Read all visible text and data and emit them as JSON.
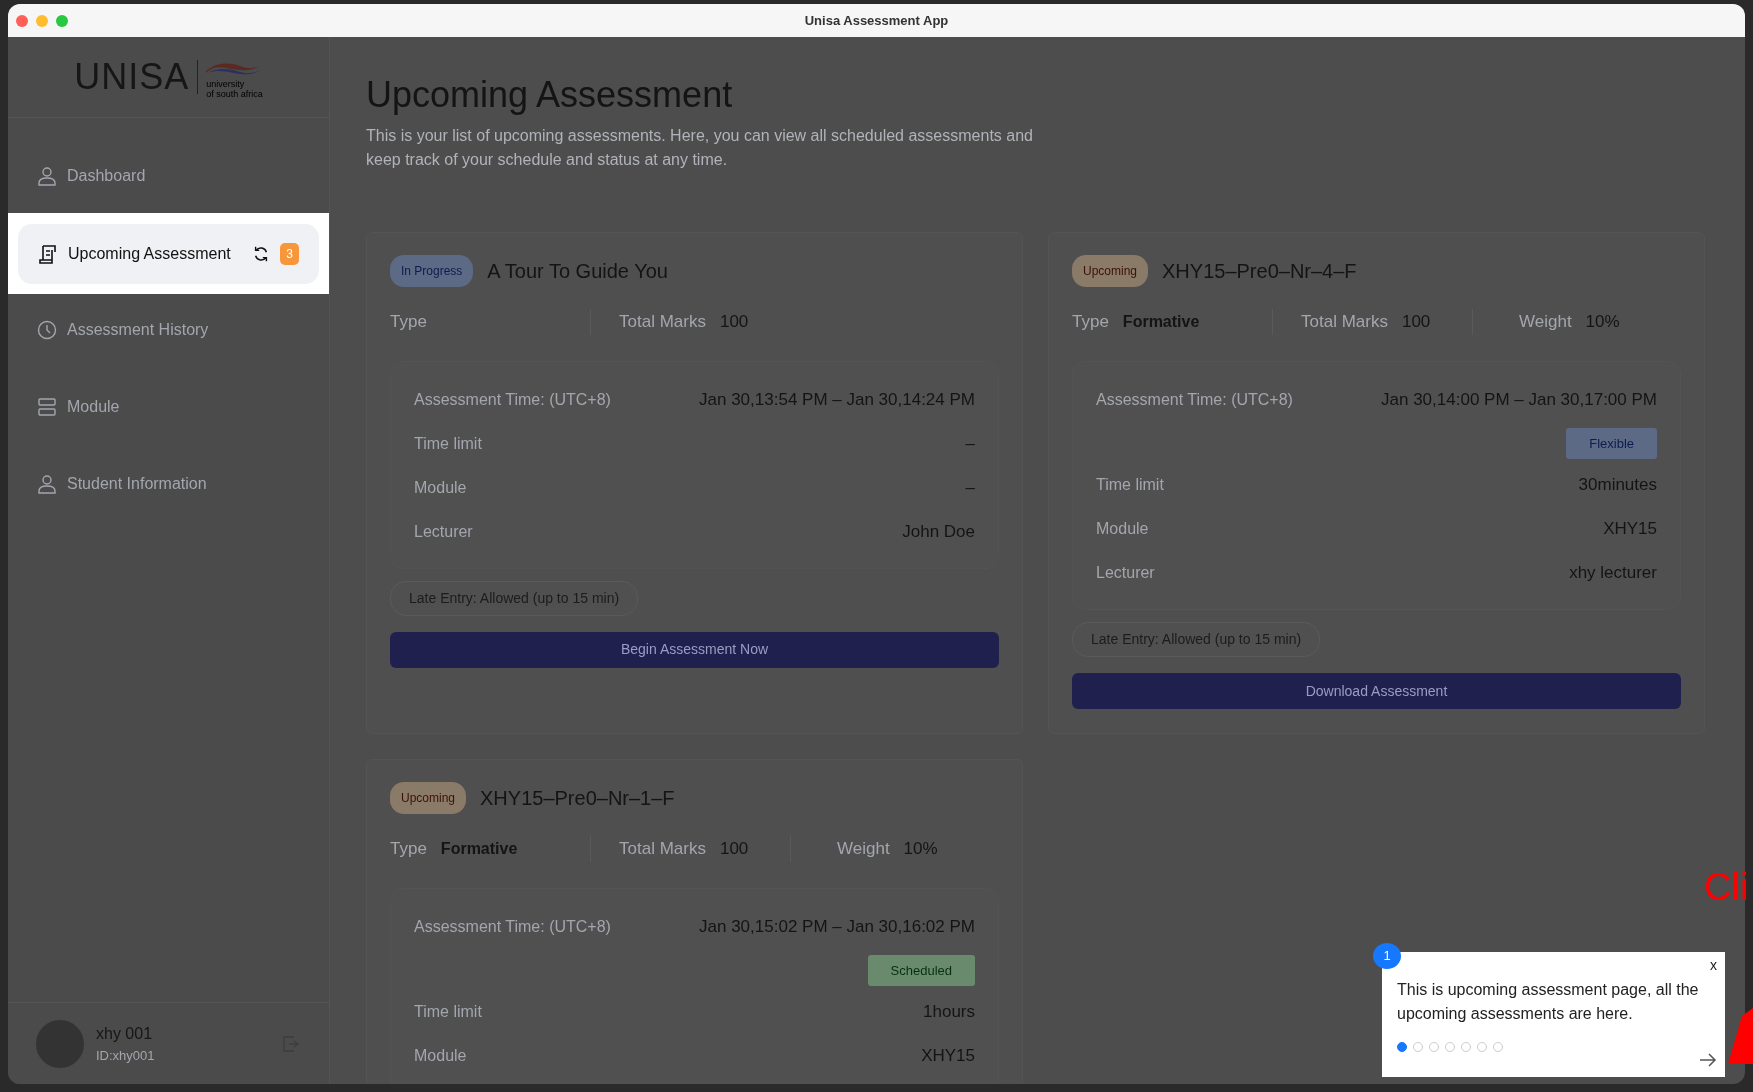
{
  "window": {
    "title": "Unisa Assessment App"
  },
  "sidebar": {
    "logo": {
      "name": "UNISA",
      "tagline": [
        "university",
        "of south africa"
      ]
    },
    "items": [
      {
        "label": "Dashboard",
        "kind": "person",
        "selected": false
      },
      {
        "label": "Upcoming Assessment",
        "kind": "document",
        "selected": true,
        "count": "3"
      },
      {
        "label": "Assessment History",
        "kind": "clock",
        "selected": false
      },
      {
        "label": "Module",
        "kind": "stack",
        "selected": false
      },
      {
        "label": "Student Information",
        "kind": "person",
        "selected": false
      }
    ],
    "user": {
      "name": "xhy 001",
      "id": "ID:xhy001"
    }
  },
  "page": {
    "title": "Upcoming Assessment",
    "description": "This is your list of upcoming assessments. Here, you can view all scheduled assessments and keep track of your schedule and status at any time."
  },
  "assessments": [
    {
      "status": {
        "text": "In Progress",
        "kind": "in_progress"
      },
      "title": "A Tour To Guide You",
      "type_label": "Type",
      "total_marks_label": "Total Marks",
      "total_marks": "100",
      "time_label": "Assessment Time: (UTC+8)",
      "time_value": "Jan 30,13:54 PM – Jan 30,14:24 PM",
      "details": [
        {
          "label": "Time limit",
          "value": "–"
        },
        {
          "label": "Module",
          "value": "–"
        },
        {
          "label": "Lecturer",
          "value": "John Doe"
        }
      ],
      "late_entry": "Late Entry: Allowed (up to 15 min)",
      "action": "Begin Assessment Now"
    },
    {
      "status": {
        "text": "Upcoming",
        "kind": "upcoming"
      },
      "title": "XHY15–Pre0–Nr–4–F",
      "type_label": "Type",
      "type_value": "Formative",
      "total_marks_label": "Total Marks",
      "total_marks": "100",
      "weight_label": "Weight",
      "weight": "10%",
      "time_label": "Assessment Time: (UTC+8)",
      "time_value": "Jan 30,14:00 PM – Jan 30,17:00 PM",
      "window_tag": {
        "text": "Flexible",
        "kind": "flexible"
      },
      "details": [
        {
          "label": "Time limit",
          "value": "30minutes"
        },
        {
          "label": "Module",
          "value": "XHY15"
        },
        {
          "label": "Lecturer",
          "value": "xhy lecturer"
        }
      ],
      "late_entry": "Late Entry: Allowed (up to 15 min)",
      "action": "Download Assessment"
    },
    {
      "status": {
        "text": "Upcoming",
        "kind": "upcoming"
      },
      "title": "XHY15–Pre0–Nr–1–F",
      "type_label": "Type",
      "type_value": "Formative",
      "total_marks_label": "Total Marks",
      "total_marks": "100",
      "weight_label": "Weight",
      "weight": "10%",
      "time_label": "Assessment Time: (UTC+8)",
      "time_value": "Jan 30,15:02 PM – Jan 30,16:02 PM",
      "window_tag": {
        "text": "Scheduled",
        "kind": "scheduled"
      },
      "details": [
        {
          "label": "Time limit",
          "value": "1hours"
        },
        {
          "label": "Module",
          "value": "XHY15"
        }
      ]
    }
  ],
  "tour": {
    "step": "1",
    "close": "x",
    "text": "This is upcoming assessment page, all the upcoming assessments are here.",
    "dots": [
      {
        "selected": true
      },
      {
        "selected": false
      },
      {
        "selected": false
      },
      {
        "selected": false
      },
      {
        "selected": false
      },
      {
        "selected": false
      },
      {
        "selected": false
      }
    ]
  },
  "annotation": {
    "text": "Cli"
  }
}
